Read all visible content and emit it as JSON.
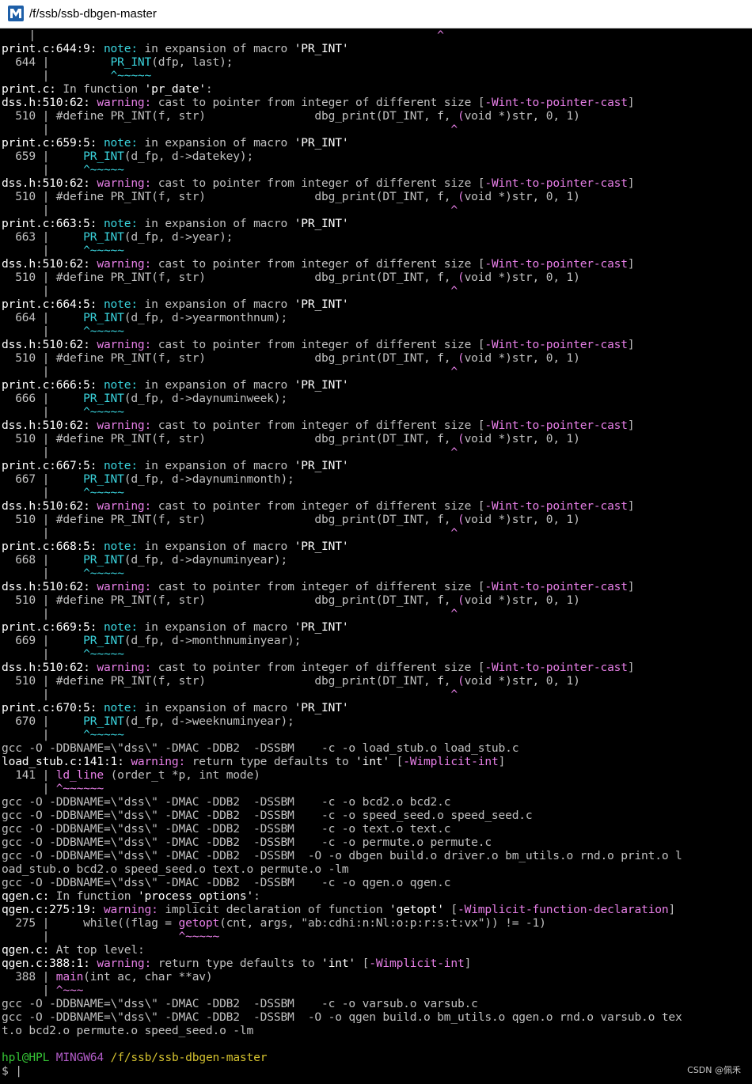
{
  "window": {
    "title": "/f/ssb/ssb-dbgen-master",
    "icon": "msys2-mingw-icon"
  },
  "colors": {
    "background": "#000000",
    "default_text": "#c0c0c0",
    "bold_text": "#ffffff",
    "warning": "#e77fe7",
    "note": "#3ad4dd",
    "prompt_user": "#35c635",
    "prompt_system": "#b25cc8",
    "prompt_path": "#d3c12f"
  },
  "terminal": {
    "lines": [
      [
        [
          "d",
          "    |                                                           "
        ],
        [
          "m",
          "^"
        ]
      ],
      [
        [
          "w",
          "print.c:644:9: "
        ],
        [
          "c",
          "note:"
        ],
        [
          "d",
          " in expansion of macro "
        ],
        [
          "w",
          "'PR_INT'"
        ]
      ],
      [
        [
          "d",
          "  644 |         "
        ],
        [
          "c",
          "PR_INT"
        ],
        [
          "d",
          "(dfp, last);"
        ]
      ],
      [
        [
          "d",
          "      |         "
        ],
        [
          "c",
          "^~~~~~"
        ]
      ],
      [
        [
          "w",
          "print.c:"
        ],
        [
          "d",
          " In function "
        ],
        [
          "w",
          "'pr_date'"
        ],
        [
          "d",
          ":"
        ]
      ],
      [
        [
          "w",
          "dss.h:510:62: "
        ],
        [
          "m",
          "warning:"
        ],
        [
          "d",
          " cast to pointer from integer of different size ["
        ],
        [
          "m",
          "-Wint-to-pointer-cast"
        ],
        [
          "d",
          "]"
        ]
      ],
      [
        [
          "d",
          "  510 | #define PR_INT(f, str)                dbg_print(DT_INT, f, "
        ],
        [
          "m",
          "("
        ],
        [
          "d",
          "void *)str, 0, 1)"
        ]
      ],
      [
        [
          "d",
          "      |                                                           "
        ],
        [
          "m",
          "^"
        ]
      ],
      [
        [
          "w",
          "print.c:659:5: "
        ],
        [
          "c",
          "note:"
        ],
        [
          "d",
          " in expansion of macro "
        ],
        [
          "w",
          "'PR_INT'"
        ]
      ],
      [
        [
          "d",
          "  659 |     "
        ],
        [
          "c",
          "PR_INT"
        ],
        [
          "d",
          "(d_fp, d->datekey);"
        ]
      ],
      [
        [
          "d",
          "      |     "
        ],
        [
          "c",
          "^~~~~~"
        ]
      ],
      [
        [
          "w",
          "dss.h:510:62: "
        ],
        [
          "m",
          "warning:"
        ],
        [
          "d",
          " cast to pointer from integer of different size ["
        ],
        [
          "m",
          "-Wint-to-pointer-cast"
        ],
        [
          "d",
          "]"
        ]
      ],
      [
        [
          "d",
          "  510 | #define PR_INT(f, str)                dbg_print(DT_INT, f, "
        ],
        [
          "m",
          "("
        ],
        [
          "d",
          "void *)str, 0, 1)"
        ]
      ],
      [
        [
          "d",
          "      |                                                           "
        ],
        [
          "m",
          "^"
        ]
      ],
      [
        [
          "w",
          "print.c:663:5: "
        ],
        [
          "c",
          "note:"
        ],
        [
          "d",
          " in expansion of macro "
        ],
        [
          "w",
          "'PR_INT'"
        ]
      ],
      [
        [
          "d",
          "  663 |     "
        ],
        [
          "c",
          "PR_INT"
        ],
        [
          "d",
          "(d_fp, d->year);"
        ]
      ],
      [
        [
          "d",
          "      |     "
        ],
        [
          "c",
          "^~~~~~"
        ]
      ],
      [
        [
          "w",
          "dss.h:510:62: "
        ],
        [
          "m",
          "warning:"
        ],
        [
          "d",
          " cast to pointer from integer of different size ["
        ],
        [
          "m",
          "-Wint-to-pointer-cast"
        ],
        [
          "d",
          "]"
        ]
      ],
      [
        [
          "d",
          "  510 | #define PR_INT(f, str)                dbg_print(DT_INT, f, "
        ],
        [
          "m",
          "("
        ],
        [
          "d",
          "void *)str, 0, 1)"
        ]
      ],
      [
        [
          "d",
          "      |                                                           "
        ],
        [
          "m",
          "^"
        ]
      ],
      [
        [
          "w",
          "print.c:664:5: "
        ],
        [
          "c",
          "note:"
        ],
        [
          "d",
          " in expansion of macro "
        ],
        [
          "w",
          "'PR_INT'"
        ]
      ],
      [
        [
          "d",
          "  664 |     "
        ],
        [
          "c",
          "PR_INT"
        ],
        [
          "d",
          "(d_fp, d->yearmonthnum);"
        ]
      ],
      [
        [
          "d",
          "      |     "
        ],
        [
          "c",
          "^~~~~~"
        ]
      ],
      [
        [
          "w",
          "dss.h:510:62: "
        ],
        [
          "m",
          "warning:"
        ],
        [
          "d",
          " cast to pointer from integer of different size ["
        ],
        [
          "m",
          "-Wint-to-pointer-cast"
        ],
        [
          "d",
          "]"
        ]
      ],
      [
        [
          "d",
          "  510 | #define PR_INT(f, str)                dbg_print(DT_INT, f, "
        ],
        [
          "m",
          "("
        ],
        [
          "d",
          "void *)str, 0, 1)"
        ]
      ],
      [
        [
          "d",
          "      |                                                           "
        ],
        [
          "m",
          "^"
        ]
      ],
      [
        [
          "w",
          "print.c:666:5: "
        ],
        [
          "c",
          "note:"
        ],
        [
          "d",
          " in expansion of macro "
        ],
        [
          "w",
          "'PR_INT'"
        ]
      ],
      [
        [
          "d",
          "  666 |     "
        ],
        [
          "c",
          "PR_INT"
        ],
        [
          "d",
          "(d_fp, d->daynuminweek);"
        ]
      ],
      [
        [
          "d",
          "      |     "
        ],
        [
          "c",
          "^~~~~~"
        ]
      ],
      [
        [
          "w",
          "dss.h:510:62: "
        ],
        [
          "m",
          "warning:"
        ],
        [
          "d",
          " cast to pointer from integer of different size ["
        ],
        [
          "m",
          "-Wint-to-pointer-cast"
        ],
        [
          "d",
          "]"
        ]
      ],
      [
        [
          "d",
          "  510 | #define PR_INT(f, str)                dbg_print(DT_INT, f, "
        ],
        [
          "m",
          "("
        ],
        [
          "d",
          "void *)str, 0, 1)"
        ]
      ],
      [
        [
          "d",
          "      |                                                           "
        ],
        [
          "m",
          "^"
        ]
      ],
      [
        [
          "w",
          "print.c:667:5: "
        ],
        [
          "c",
          "note:"
        ],
        [
          "d",
          " in expansion of macro "
        ],
        [
          "w",
          "'PR_INT'"
        ]
      ],
      [
        [
          "d",
          "  667 |     "
        ],
        [
          "c",
          "PR_INT"
        ],
        [
          "d",
          "(d_fp, d->daynuminmonth);"
        ]
      ],
      [
        [
          "d",
          "      |     "
        ],
        [
          "c",
          "^~~~~~"
        ]
      ],
      [
        [
          "w",
          "dss.h:510:62: "
        ],
        [
          "m",
          "warning:"
        ],
        [
          "d",
          " cast to pointer from integer of different size ["
        ],
        [
          "m",
          "-Wint-to-pointer-cast"
        ],
        [
          "d",
          "]"
        ]
      ],
      [
        [
          "d",
          "  510 | #define PR_INT(f, str)                dbg_print(DT_INT, f, "
        ],
        [
          "m",
          "("
        ],
        [
          "d",
          "void *)str, 0, 1)"
        ]
      ],
      [
        [
          "d",
          "      |                                                           "
        ],
        [
          "m",
          "^"
        ]
      ],
      [
        [
          "w",
          "print.c:668:5: "
        ],
        [
          "c",
          "note:"
        ],
        [
          "d",
          " in expansion of macro "
        ],
        [
          "w",
          "'PR_INT'"
        ]
      ],
      [
        [
          "d",
          "  668 |     "
        ],
        [
          "c",
          "PR_INT"
        ],
        [
          "d",
          "(d_fp, d->daynuminyear);"
        ]
      ],
      [
        [
          "d",
          "      |     "
        ],
        [
          "c",
          "^~~~~~"
        ]
      ],
      [
        [
          "w",
          "dss.h:510:62: "
        ],
        [
          "m",
          "warning:"
        ],
        [
          "d",
          " cast to pointer from integer of different size ["
        ],
        [
          "m",
          "-Wint-to-pointer-cast"
        ],
        [
          "d",
          "]"
        ]
      ],
      [
        [
          "d",
          "  510 | #define PR_INT(f, str)                dbg_print(DT_INT, f, "
        ],
        [
          "m",
          "("
        ],
        [
          "d",
          "void *)str, 0, 1)"
        ]
      ],
      [
        [
          "d",
          "      |                                                           "
        ],
        [
          "m",
          "^"
        ]
      ],
      [
        [
          "w",
          "print.c:669:5: "
        ],
        [
          "c",
          "note:"
        ],
        [
          "d",
          " in expansion of macro "
        ],
        [
          "w",
          "'PR_INT'"
        ]
      ],
      [
        [
          "d",
          "  669 |     "
        ],
        [
          "c",
          "PR_INT"
        ],
        [
          "d",
          "(d_fp, d->monthnuminyear);"
        ]
      ],
      [
        [
          "d",
          "      |     "
        ],
        [
          "c",
          "^~~~~~"
        ]
      ],
      [
        [
          "w",
          "dss.h:510:62: "
        ],
        [
          "m",
          "warning:"
        ],
        [
          "d",
          " cast to pointer from integer of different size ["
        ],
        [
          "m",
          "-Wint-to-pointer-cast"
        ],
        [
          "d",
          "]"
        ]
      ],
      [
        [
          "d",
          "  510 | #define PR_INT(f, str)                dbg_print(DT_INT, f, "
        ],
        [
          "m",
          "("
        ],
        [
          "d",
          "void *)str, 0, 1)"
        ]
      ],
      [
        [
          "d",
          "      |                                                           "
        ],
        [
          "m",
          "^"
        ]
      ],
      [
        [
          "w",
          "print.c:670:5: "
        ],
        [
          "c",
          "note:"
        ],
        [
          "d",
          " in expansion of macro "
        ],
        [
          "w",
          "'PR_INT'"
        ]
      ],
      [
        [
          "d",
          "  670 |     "
        ],
        [
          "c",
          "PR_INT"
        ],
        [
          "d",
          "(d_fp, d->weeknuminyear);"
        ]
      ],
      [
        [
          "d",
          "      |     "
        ],
        [
          "c",
          "^~~~~~"
        ]
      ],
      [
        [
          "d",
          "gcc -O -DDBNAME=\\\"dss\\\" -DMAC -DDB2  -DSSBM    -c -o load_stub.o load_stub.c"
        ]
      ],
      [
        [
          "w",
          "load_stub.c:141:1: "
        ],
        [
          "m",
          "warning:"
        ],
        [
          "d",
          " return type defaults to "
        ],
        [
          "w",
          "'int'"
        ],
        [
          "d",
          " ["
        ],
        [
          "m",
          "-Wimplicit-int"
        ],
        [
          "d",
          "]"
        ]
      ],
      [
        [
          "d",
          "  141 | "
        ],
        [
          "m",
          "ld_line"
        ],
        [
          "d",
          " (order_t *p, int mode)"
        ]
      ],
      [
        [
          "d",
          "      | "
        ],
        [
          "m",
          "^~~~~~~"
        ]
      ],
      [
        [
          "d",
          "gcc -O -DDBNAME=\\\"dss\\\" -DMAC -DDB2  -DSSBM    -c -o bcd2.o bcd2.c"
        ]
      ],
      [
        [
          "d",
          "gcc -O -DDBNAME=\\\"dss\\\" -DMAC -DDB2  -DSSBM    -c -o speed_seed.o speed_seed.c"
        ]
      ],
      [
        [
          "d",
          "gcc -O -DDBNAME=\\\"dss\\\" -DMAC -DDB2  -DSSBM    -c -o text.o text.c"
        ]
      ],
      [
        [
          "d",
          "gcc -O -DDBNAME=\\\"dss\\\" -DMAC -DDB2  -DSSBM    -c -o permute.o permute.c"
        ]
      ],
      [
        [
          "d",
          "gcc -O -DDBNAME=\\\"dss\\\" -DMAC -DDB2  -DSSBM  -O -o dbgen build.o driver.o bm_utils.o rnd.o print.o l"
        ]
      ],
      [
        [
          "d",
          "oad_stub.o bcd2.o speed_seed.o text.o permute.o -lm"
        ]
      ],
      [
        [
          "d",
          "gcc -O -DDBNAME=\\\"dss\\\" -DMAC -DDB2  -DSSBM    -c -o qgen.o qgen.c"
        ]
      ],
      [
        [
          "w",
          "qgen.c:"
        ],
        [
          "d",
          " In function "
        ],
        [
          "w",
          "'process_options'"
        ],
        [
          "d",
          ":"
        ]
      ],
      [
        [
          "w",
          "qgen.c:275:19: "
        ],
        [
          "m",
          "warning:"
        ],
        [
          "d",
          " implicit declaration of function "
        ],
        [
          "w",
          "'getopt'"
        ],
        [
          "d",
          " ["
        ],
        [
          "m",
          "-Wimplicit-function-declaration"
        ],
        [
          "d",
          "]"
        ]
      ],
      [
        [
          "d",
          "  275 |     while((flag = "
        ],
        [
          "m",
          "getopt"
        ],
        [
          "d",
          "(cnt, args, \"ab:cdhi:n:Nl:o:p:r:s:t:vx\")) != -1)"
        ]
      ],
      [
        [
          "d",
          "      |                   "
        ],
        [
          "m",
          "^~~~~~"
        ]
      ],
      [
        [
          "w",
          "qgen.c:"
        ],
        [
          "d",
          " At top level:"
        ]
      ],
      [
        [
          "w",
          "qgen.c:388:1: "
        ],
        [
          "m",
          "warning:"
        ],
        [
          "d",
          " return type defaults to "
        ],
        [
          "w",
          "'int'"
        ],
        [
          "d",
          " ["
        ],
        [
          "m",
          "-Wimplicit-int"
        ],
        [
          "d",
          "]"
        ]
      ],
      [
        [
          "d",
          "  388 | "
        ],
        [
          "m",
          "main"
        ],
        [
          "d",
          "(int ac, char **av)"
        ]
      ],
      [
        [
          "d",
          "      | "
        ],
        [
          "m",
          "^~~~"
        ]
      ],
      [
        [
          "d",
          "gcc -O -DDBNAME=\\\"dss\\\" -DMAC -DDB2  -DSSBM    -c -o varsub.o varsub.c"
        ]
      ],
      [
        [
          "d",
          "gcc -O -DDBNAME=\\\"dss\\\" -DMAC -DDB2  -DSSBM  -O -o qgen build.o bm_utils.o qgen.o rnd.o varsub.o tex"
        ]
      ],
      [
        [
          "d",
          "t.o bcd2.o permute.o speed_seed.o -lm"
        ]
      ],
      [
        [
          "d",
          ""
        ]
      ],
      [
        [
          "g",
          "hpl@HPL"
        ],
        [
          "d",
          " "
        ],
        [
          "p",
          "MINGW64"
        ],
        [
          "d",
          " "
        ],
        [
          "y",
          "/f/ssb/ssb-dbgen-master"
        ]
      ],
      [
        [
          "d",
          "$ |"
        ]
      ]
    ]
  },
  "watermark": "CSDN @佩禾"
}
